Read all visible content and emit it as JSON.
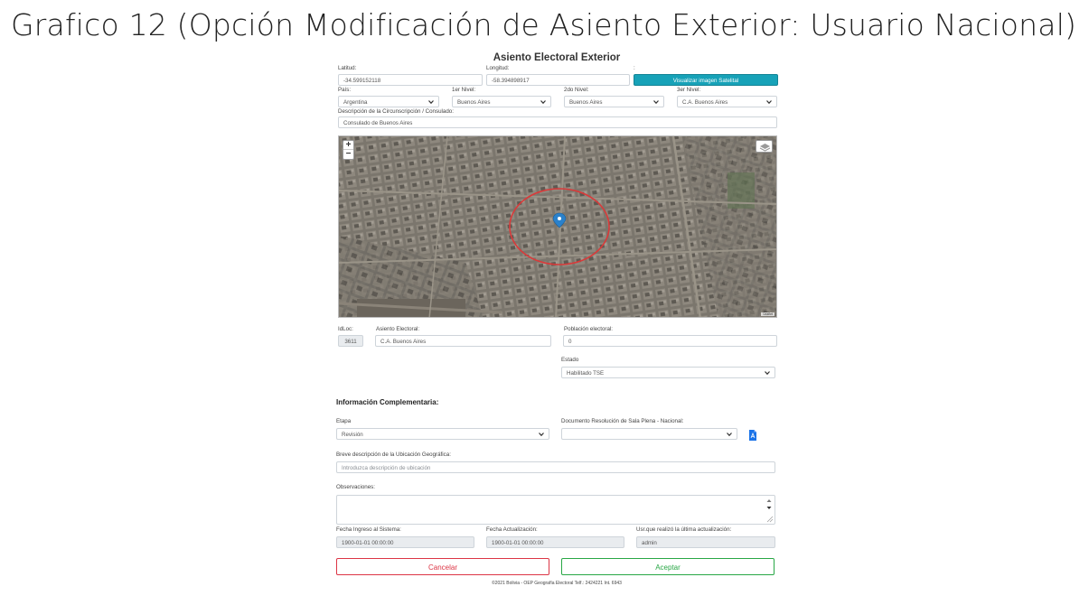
{
  "slide_title": "Grafico 12 (Opción Modificación de Asiento Exterior: Usuario Nacional)",
  "form_title": "Asiento Electoral Exterior",
  "coords": {
    "lat_label": "Latitud:",
    "lat_value": "-34.599152118",
    "lon_label": "Longitud:",
    "lon_value": "-58.394898917",
    "extra_label": ":",
    "satellite_button": "Visualizar imagen Satelital"
  },
  "levels": {
    "pais_label": "País:",
    "pais_value": "Argentina",
    "n1_label": "1er Nivel:",
    "n1_value": "Buenos Aires",
    "n2_label": "2do Nivel:",
    "n2_value": "Buenos Aires",
    "n3_label": "3er Nivel:",
    "n3_value": "C.A. Buenos Aires"
  },
  "circ": {
    "label": "Descripción de la Circunscripción / Consulado:",
    "value": "Consulado de Buenos Aires"
  },
  "map": {
    "zoom_in": "+",
    "zoom_out": "−",
    "attribution": "Leaflet"
  },
  "asiento": {
    "idloc_label": "IdLoc:",
    "idloc_value": "3611",
    "asiento_label": "Asiento Electoral:",
    "asiento_value": "C.A. Buenos Aires",
    "poblacion_label": "Población electoral:",
    "poblacion_value": "0",
    "estado_label": "Estado",
    "estado_value": "Habilitado TSE"
  },
  "complementaria": {
    "title": "Información Complementaria:",
    "etapa_label": "Etapa",
    "etapa_value": "Revisión",
    "doc_label": "Documento Resolución de Sala Plena - Nacional:",
    "doc_value": "",
    "breve_label": "Breve descripción de la Ubicación Geográfica:",
    "breve_placeholder": "Introduzca descripción de ubicación",
    "obs_label": "Observaciones:"
  },
  "audit": {
    "ingreso_label": "Fecha Ingreso al Sistema:",
    "ingreso_value": "1900-01-01 00:00:00",
    "actualizacion_label": "Fecha Actualización:",
    "actualizacion_value": "1900-01-01 00:00:00",
    "usr_label": "Usr.que realizó la última actualización:",
    "usr_value": "admin"
  },
  "buttons": {
    "cancel": "Cancelar",
    "accept": "Aceptar"
  },
  "footer": "©2021 Bolivia - OEP Geografía Electoral Telf.: 2424221 Int. 6943",
  "colors": {
    "teal": "#17a2b8",
    "danger": "#dc3545",
    "success": "#28a745",
    "marker": "#2a81cb",
    "circle": "#d93a3a"
  }
}
